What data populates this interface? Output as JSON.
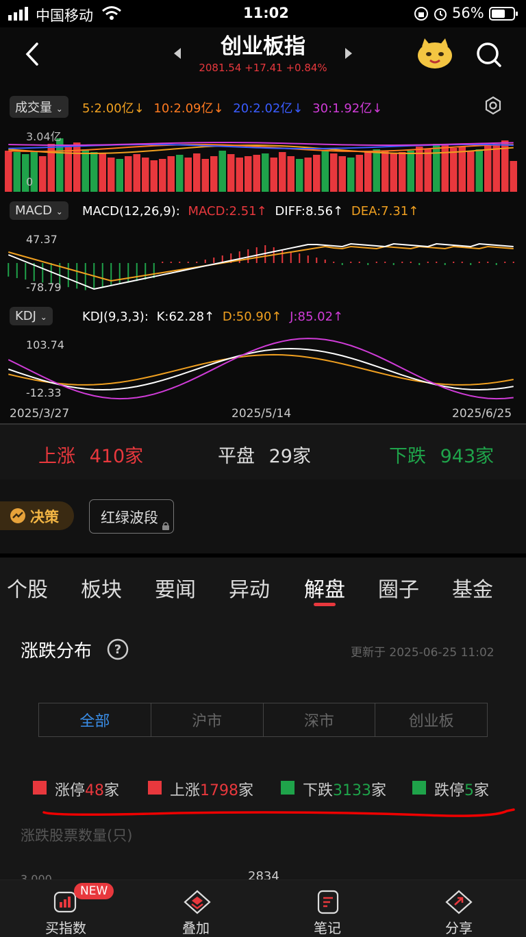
{
  "status_bar": {
    "carrier": "中国移动",
    "time": "11:02",
    "battery": "56%"
  },
  "header": {
    "title": "创业板指",
    "price": "2081.54",
    "change": "+17.41",
    "pct": "+0.84%"
  },
  "volume": {
    "selector": "成交量",
    "ma5": "5:2.00亿↓",
    "ma10": "10:2.09亿↓",
    "ma20": "20:2.02亿↓",
    "ma30": "30:1.92亿↓",
    "ymax": "3.04亿",
    "ymin": "0"
  },
  "macd": {
    "selector": "MACD",
    "params": "MACD(12,26,9):",
    "macd": "MACD:2.51↑",
    "diff": "DIFF:8.56↑",
    "dea": "DEA:7.31↑",
    "ymax": "47.37",
    "ymin": "-78.79"
  },
  "kdj": {
    "selector": "KDJ",
    "params": "KDJ(9,3,3):",
    "k": "K:62.28↑",
    "d": "D:50.90↑",
    "j": "J:85.02↑",
    "ymax": "103.74",
    "ymin": "-12.33"
  },
  "dates": {
    "start": "2025/3/27",
    "mid": "2025/5/14",
    "end": "2025/6/25"
  },
  "breadth": {
    "up_label": "上涨",
    "up": "410家",
    "flat_label": "平盘",
    "flat": "29家",
    "down_label": "下跌",
    "down": "943家"
  },
  "decision": {
    "badge": "决策",
    "button": "红绿波段"
  },
  "tabs": [
    "个股",
    "板块",
    "要闻",
    "异动",
    "解盘",
    "圈子",
    "基金"
  ],
  "section": {
    "title": "涨跌分布",
    "updated": "更新于 2025-06-25 11:02"
  },
  "segments": [
    "全部",
    "沪市",
    "深市",
    "创业板"
  ],
  "legend": {
    "limit_up_label": "涨停",
    "limit_up": "48",
    "up_label": "上涨",
    "up": "1798",
    "down_label": "下跌",
    "down": "3133",
    "limit_down_label": "跌停",
    "limit_down": "5",
    "unit": "家"
  },
  "dist_chart": {
    "title": "涨跌股票数量(只)",
    "ytick": "3,000",
    "peak": "2834"
  },
  "bottom_nav": {
    "buy": "买指数",
    "badge": "NEW",
    "overlay": "叠加",
    "notes": "笔记",
    "share": "分享"
  },
  "colors": {
    "red": "#e8383d",
    "green": "#1fa34a",
    "orange": "#f0a020",
    "blue": "#3a5cff",
    "magenta": "#d03cd8",
    "accent": "#3a8ee8"
  }
}
